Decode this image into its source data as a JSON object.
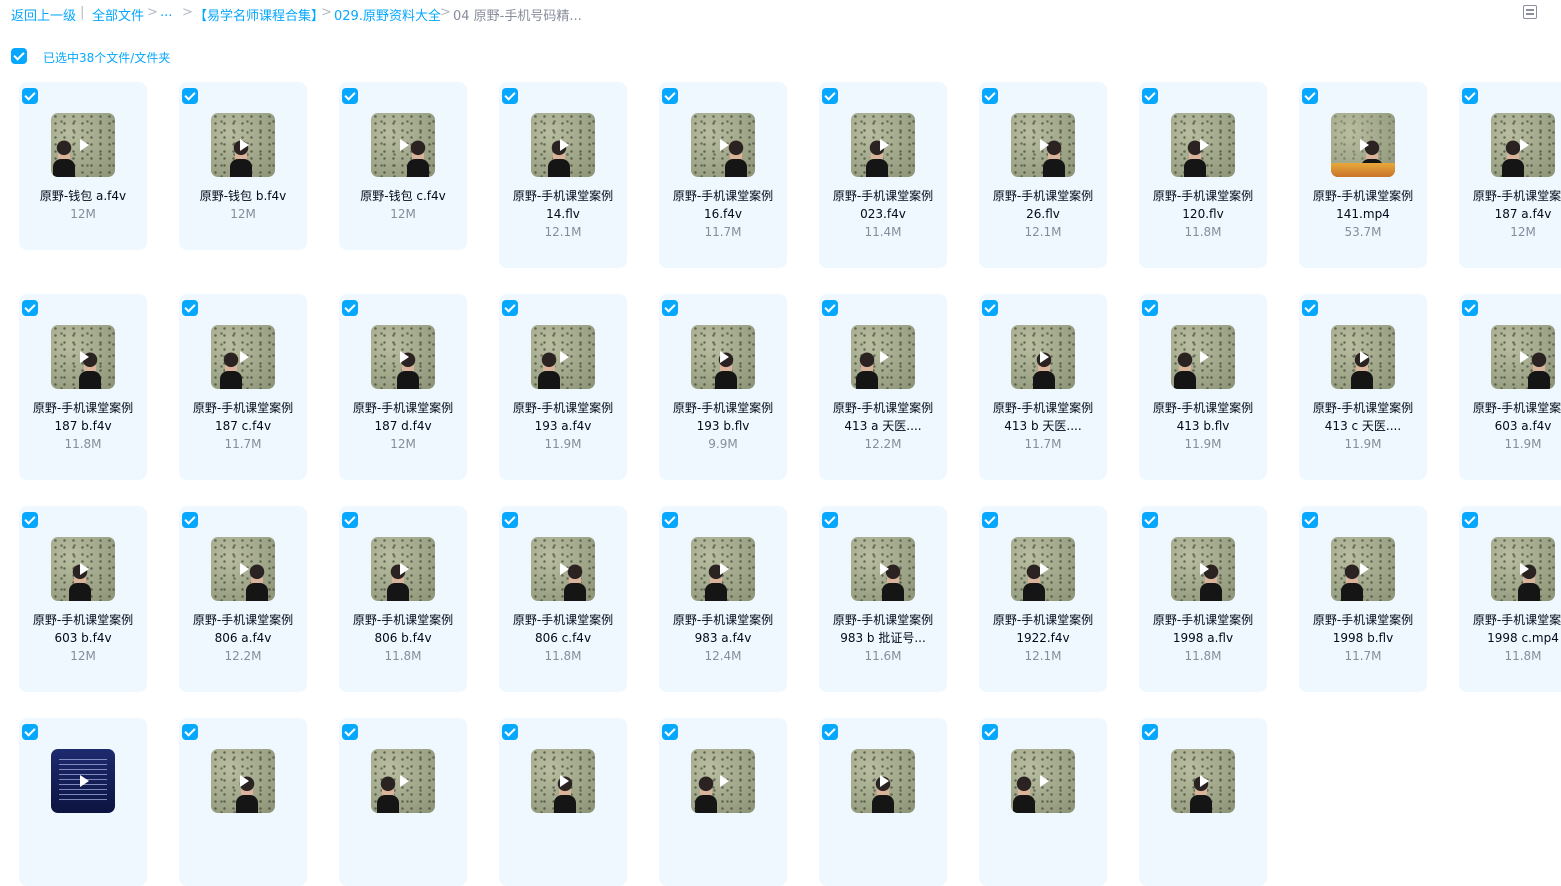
{
  "breadcrumb": {
    "back": "返回上一级",
    "all_files": "全部文件",
    "ellipsis": "...",
    "folder1": "【易学名师课程合集】",
    "folder2": "029.原野资料大全",
    "current": "04 原野-手机号码精...",
    "separator1": "|",
    "separator2": ">",
    "separator3": ">",
    "separator4": ">",
    "separator5": ">"
  },
  "view_toggle_icon": "list-view-icon",
  "selection": {
    "label": "已选中38个文件/文件夹",
    "checked": true
  },
  "colors": {
    "accent": "#06a7ff",
    "card_bg": "#eef8fe",
    "size_text": "#878c9c"
  },
  "files": [
    {
      "name": [
        "原野-钱包 a.f4v"
      ],
      "size": "12M"
    },
    {
      "name": [
        "原野-钱包 b.f4v"
      ],
      "size": "12M"
    },
    {
      "name": [
        "原野-钱包 c.f4v"
      ],
      "size": "12M"
    },
    {
      "name": [
        "原野-手机课堂案例",
        "14.flv"
      ],
      "size": "12.1M"
    },
    {
      "name": [
        "原野-手机课堂案例",
        "16.f4v"
      ],
      "size": "11.7M"
    },
    {
      "name": [
        "原野-手机课堂案例",
        "023.f4v"
      ],
      "size": "11.4M"
    },
    {
      "name": [
        "原野-手机课堂案例",
        "26.flv"
      ],
      "size": "12.1M"
    },
    {
      "name": [
        "原野-手机课堂案例",
        "120.flv"
      ],
      "size": "11.8M"
    },
    {
      "name": [
        "原野-手机课堂案例",
        "141.mp4"
      ],
      "size": "53.7M"
    },
    {
      "name": [
        "原野-手机课堂案例",
        "187 a.f4v"
      ],
      "size": "12M"
    },
    {
      "name": [
        "原野-手机课堂案例",
        "187 b.f4v"
      ],
      "size": "11.8M"
    },
    {
      "name": [
        "原野-手机课堂案例",
        "187 c.f4v"
      ],
      "size": "11.7M"
    },
    {
      "name": [
        "原野-手机课堂案例",
        "187 d.f4v"
      ],
      "size": "12M"
    },
    {
      "name": [
        "原野-手机课堂案例",
        "193 a.f4v"
      ],
      "size": "11.9M"
    },
    {
      "name": [
        "原野-手机课堂案例",
        "193 b.flv"
      ],
      "size": "9.9M"
    },
    {
      "name": [
        "原野-手机课堂案例",
        "413 a 天医...."
      ],
      "size": "12.2M"
    },
    {
      "name": [
        "原野-手机课堂案例",
        "413 b 天医...."
      ],
      "size": "11.7M"
    },
    {
      "name": [
        "原野-手机课堂案例",
        "413 b.flv"
      ],
      "size": "11.9M"
    },
    {
      "name": [
        "原野-手机课堂案例",
        "413 c 天医...."
      ],
      "size": "11.9M"
    },
    {
      "name": [
        "原野-手机课堂案例",
        "603 a.f4v"
      ],
      "size": "11.9M"
    },
    {
      "name": [
        "原野-手机课堂案例",
        "603 b.f4v"
      ],
      "size": "12M"
    },
    {
      "name": [
        "原野-手机课堂案例",
        "806 a.f4v"
      ],
      "size": "12.2M"
    },
    {
      "name": [
        "原野-手机课堂案例",
        "806 b.f4v"
      ],
      "size": "11.8M"
    },
    {
      "name": [
        "原野-手机课堂案例",
        "806 c.f4v"
      ],
      "size": "11.8M"
    },
    {
      "name": [
        "原野-手机课堂案例",
        "983 a.f4v"
      ],
      "size": "12.4M"
    },
    {
      "name": [
        "原野-手机课堂案例",
        "983 b 批证号..."
      ],
      "size": "11.6M"
    },
    {
      "name": [
        "原野-手机课堂案例",
        "1922.f4v"
      ],
      "size": "12.1M"
    },
    {
      "name": [
        "原野-手机课堂案例",
        "1998 a.flv"
      ],
      "size": "11.8M"
    },
    {
      "name": [
        "原野-手机课堂案例",
        "1998 b.flv"
      ],
      "size": "11.7M"
    },
    {
      "name": [
        "原野-手机课堂案例",
        "1998 c.mp4"
      ],
      "size": "11.8M"
    },
    {
      "name": [],
      "size": ""
    },
    {
      "name": [],
      "size": ""
    },
    {
      "name": [],
      "size": ""
    },
    {
      "name": [],
      "size": ""
    },
    {
      "name": [],
      "size": ""
    },
    {
      "name": [],
      "size": ""
    },
    {
      "name": [],
      "size": ""
    },
    {
      "name": [],
      "size": ""
    }
  ]
}
